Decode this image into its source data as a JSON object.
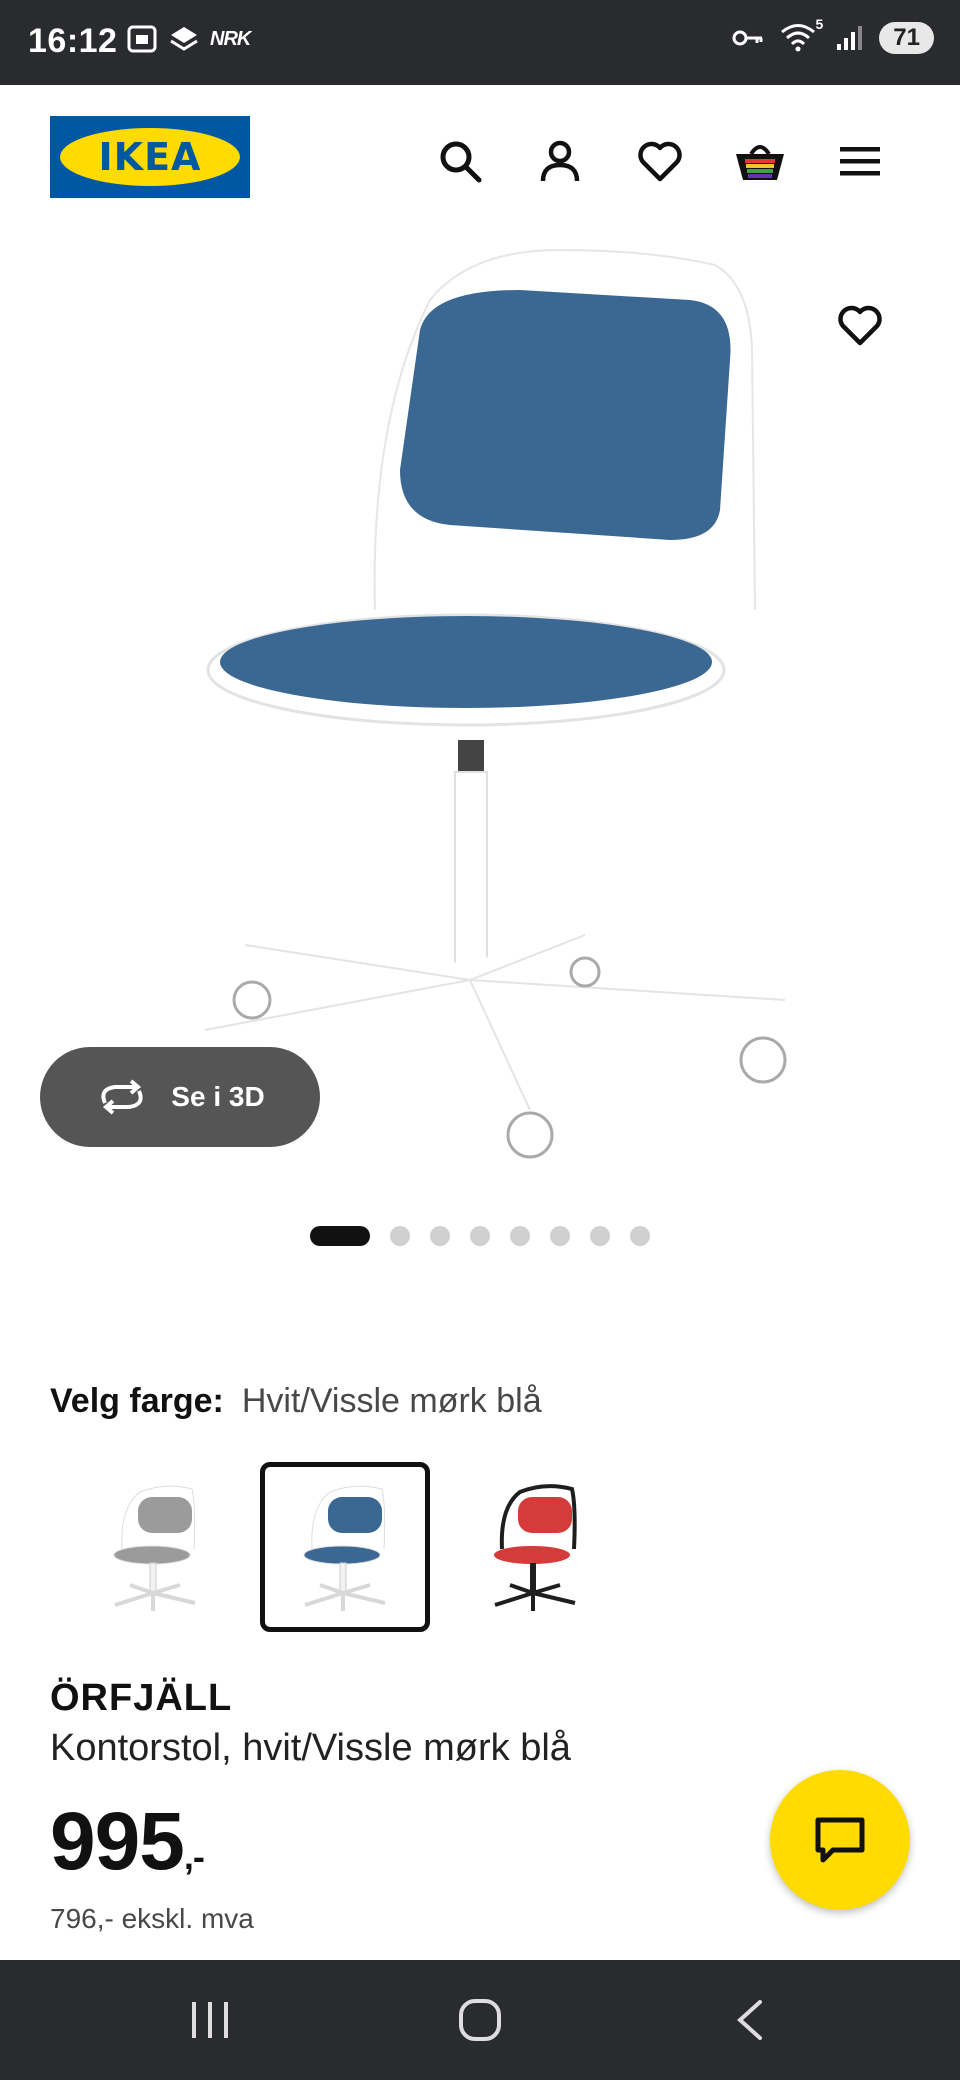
{
  "status_bar": {
    "time": "16:12",
    "carrier_badge": "NRK",
    "wifi_badge": "5",
    "battery_level": "71"
  },
  "header": {
    "logo_text": "IKEA",
    "brand_colors": {
      "blue": "#0058a3",
      "yellow": "#ffdb00"
    },
    "icons": [
      "search-icon",
      "account-icon",
      "wishlist-heart-icon",
      "shopping-cart-icon",
      "menu-hamburger-icon"
    ]
  },
  "gallery": {
    "view_3d_label": "Se i 3D",
    "image_count": 8,
    "active_index": 0
  },
  "color_picker": {
    "label": "Velg farge:",
    "selected_value": "Hvit/Vissle mørk blå",
    "swatches": [
      {
        "seat_color": "#9b9b9b",
        "base_color": "#ffffff",
        "selected": false
      },
      {
        "seat_color": "#3b6793",
        "base_color": "#ffffff",
        "selected": true
      },
      {
        "seat_color": "#d63b3b",
        "base_color": "#1e1e1e",
        "selected": false
      }
    ]
  },
  "product": {
    "name": "ÖRFJÄLL",
    "description": "Kontorstol, hvit/Vissle mørk blå",
    "price_main": "995",
    "price_suffix": ",-",
    "price_ex_vat": "796,- ekskl. mva"
  },
  "nav_bar": {
    "buttons": [
      "recent-apps-icon",
      "home-icon",
      "back-icon"
    ]
  }
}
